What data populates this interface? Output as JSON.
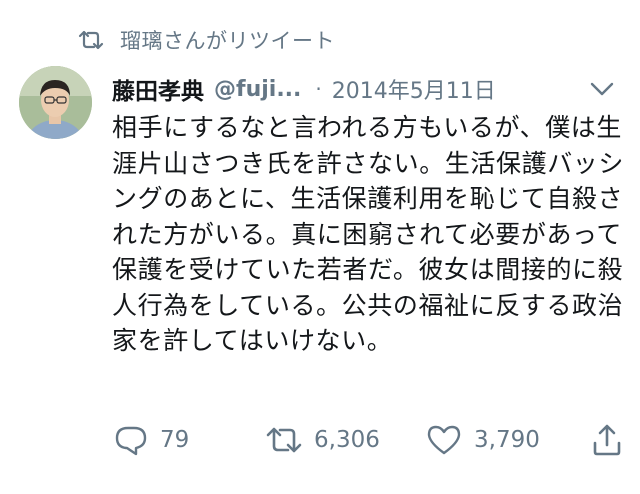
{
  "retweet_context": {
    "icon": "retweet-icon",
    "label": "瑠璃さんがリツイート"
  },
  "tweet": {
    "author_name": "藤田孝典",
    "handle": "@fuji...",
    "separator": "·",
    "timestamp": "2014年5月11日",
    "text": "相手にするなと言われる方もいるが、僕は生涯片山さつき氏を許さない。生活保護バッシングのあとに、生活保護利用を恥じて自殺された方がいる。真に困窮されて必要があって保護を受けていた若者だ。彼女は間接的に殺人行為をしている。公共の福祉に反する政治家を許してはいけない。"
  },
  "actions": {
    "reply": {
      "icon": "reply-icon",
      "count": "79"
    },
    "retweet": {
      "icon": "retweet-icon",
      "count": "6,306"
    },
    "like": {
      "icon": "heart-icon",
      "count": "3,790"
    },
    "share": {
      "icon": "share-icon"
    }
  },
  "colors": {
    "text_primary": "#14171a",
    "text_secondary": "#657786",
    "background": "#ffffff"
  }
}
